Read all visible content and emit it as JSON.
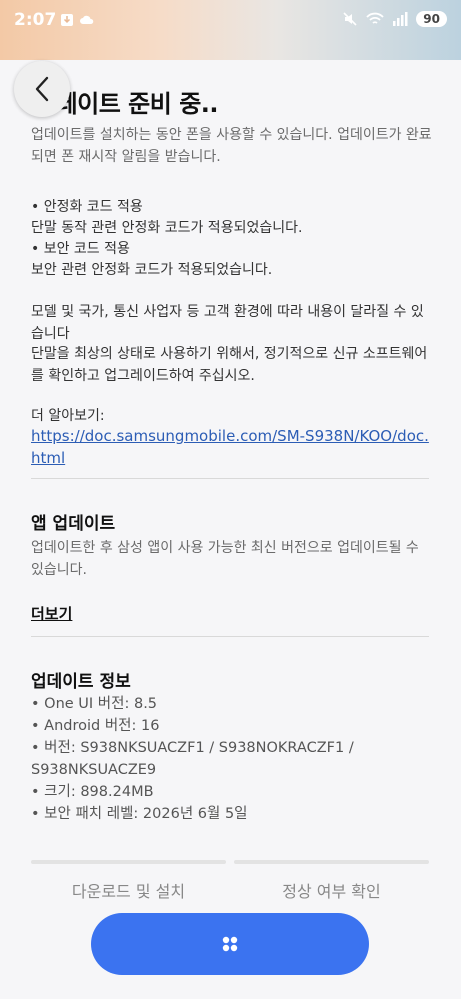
{
  "status_bar": {
    "time": "2:07",
    "battery": "90"
  },
  "header": {
    "title": "업데이트 준비 중.."
  },
  "intro": "업데이트를 설치하는 동안 폰을 사용할 수 있습니다. 업데이트가 완료되면 폰 재시작 알림을 받습니다.",
  "notes": {
    "item1_title": "• 안정화 코드 적용",
    "item1_body": "단말 동작 관련 안정화 코드가 적용되었습니다.",
    "item2_title": "• 보안 코드 적용",
    "item2_body": "보안 관련 안정화 코드가 적용되었습니다.",
    "para1": "모델 및 국가, 통신 사업자 등 고객 환경에 따라 내용이 달라질 수 있습니다",
    "para2": "단말을 최상의 상태로 사용하기 위해서, 정기적으로 신규 소프트웨어를 확인하고 업그레이드하여 주십시오.",
    "learn_more_label": "더 알아보기:",
    "learn_more_url": "https://doc.samsungmobile.com/SM-S938N/KOO/doc.html"
  },
  "app_update": {
    "title": "앱 업데이트",
    "description": "업데이트한 후 삼성 앱이 사용 가능한 최신 버전으로 업데이트될 수 있습니다.",
    "more": "더보기"
  },
  "update_info": {
    "title": "업데이트 정보",
    "oneui": "• One UI 버전: 8.5",
    "android": "• Android 버전: 16",
    "version": "• 버전: S938NKSUACZF1 / S938NOKRACZF1 / S938NKSUACZE9",
    "size": "• 크기: 898.24MB",
    "patch": "• 보안 패치 레벨: 2026년 6월 5일"
  },
  "actions": {
    "download_install": "다운로드 및 설치",
    "verify": "정상 여부 확인",
    "download_progress": 0,
    "verify_progress": 0
  },
  "colors": {
    "accent": "#3b73f0",
    "link": "#2c5db5"
  }
}
